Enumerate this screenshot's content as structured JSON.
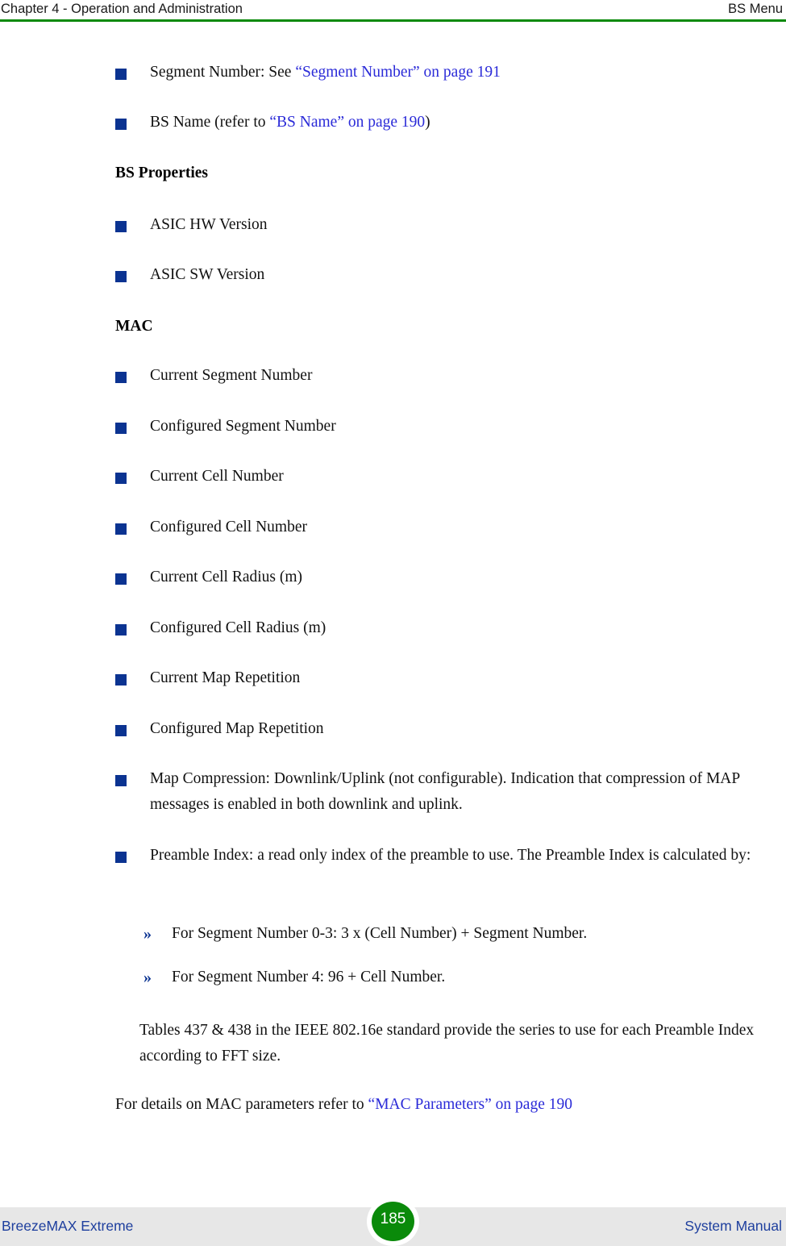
{
  "header": {
    "left": "Chapter 4 - Operation and Administration",
    "right": "BS Menu",
    "rule_color": "#0a8a0a"
  },
  "colors": {
    "bullet_square": "#0b3391",
    "link_text": "#2b2bd8",
    "footer_band": "#e7e7e7",
    "footer_text": "#1e3f9e",
    "page_badge": "#0a8a0a",
    "page_badge_text": "#ffffff"
  },
  "content": {
    "intro_bullets": [
      {
        "pre": "Segment Number: See ",
        "link": "“Segment Number” on page 191",
        "post": ""
      },
      {
        "pre": "BS Name (refer to ",
        "link": "“BS Name” on page 190",
        "post": ")"
      }
    ],
    "bs_properties_heading": "BS Properties",
    "bs_properties_bullets": [
      "ASIC HW Version",
      "ASIC SW Version"
    ],
    "mac_heading": "MAC",
    "mac_bullets": [
      "Current Segment Number",
      "Configured Segment Number",
      "Current Cell Number",
      "Configured Cell Number",
      "Current Cell Radius (m)",
      "Configured Cell Radius (m)",
      "Current Map Repetition",
      "Configured Map Repetition"
    ],
    "map_compression_bullet": "Map Compression: Downlink/Uplink (not configurable). Indication that compression of MAP messages is enabled in both downlink and uplink.",
    "preamble_index_bullet": "Preamble Index: a read only index of the preamble to use. The Preamble Index is calculated by:",
    "preamble_sub_items": [
      {
        "marker": "»",
        "text": "For Segment Number 0-3: 3 x (Cell Number) + Segment Number."
      },
      {
        "marker": "»",
        "text": "For Segment Number 4: 96 + Cell Number."
      }
    ],
    "tables_paragraph": "Tables 437 & 438 in the IEEE 802.16e standard provide the series to use for each Preamble Index according to FFT size.",
    "mac_params_paragraph": {
      "pre": "For details on MAC parameters refer to ",
      "link": "“MAC Parameters” on page 190",
      "post": ""
    }
  },
  "footer": {
    "left": "BreezeMAX Extreme",
    "page_number": "185",
    "right": "System Manual"
  }
}
